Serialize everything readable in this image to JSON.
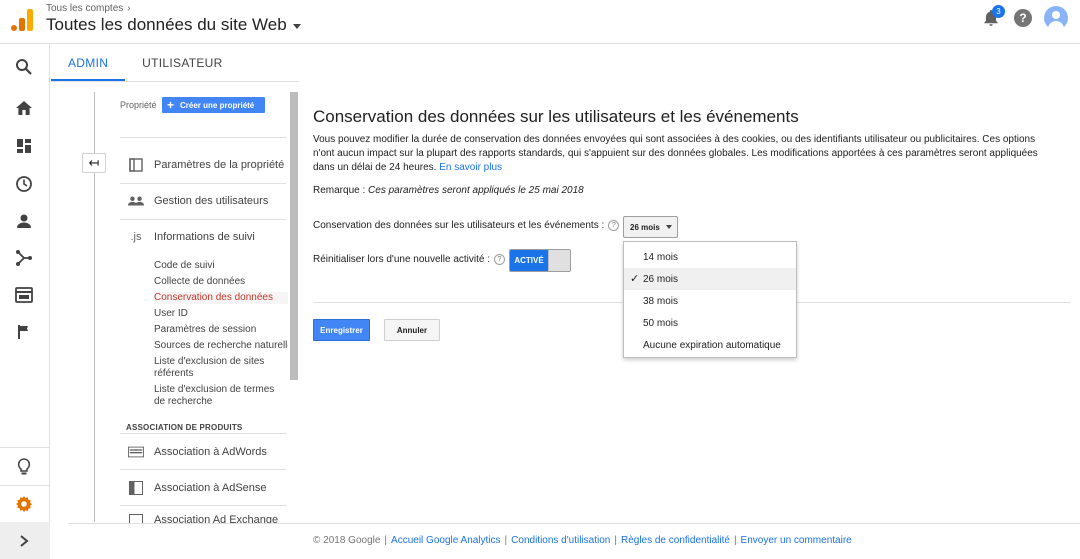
{
  "header": {
    "breadcrumb": "Tous les comptes",
    "title": "Toutes les données du site Web",
    "notification_count": "3",
    "help_glyph": "?"
  },
  "colors": {
    "accent": "#1a73e8",
    "button_blue": "#4285f4",
    "selected_item": "#c0392b",
    "logo_orange": "#f9ab00",
    "logo_dark_orange": "#e37400",
    "settings_orange": "#e37400"
  },
  "leftnav": {
    "icons": [
      "search-icon",
      "home-icon",
      "customization-icon",
      "realtime-clock-icon",
      "audience-person-icon",
      "acquisition-icon",
      "behavior-icon",
      "conversions-flag-icon",
      "discover-lightbulb-icon",
      "admin-gear-icon",
      "expand-chevron-icon"
    ]
  },
  "tabs": [
    {
      "label": "ADMIN",
      "active": true
    },
    {
      "label": "UTILISATEUR",
      "active": false
    }
  ],
  "property": {
    "label": "Propriété",
    "create_button": "Créer une propriété",
    "back_glyph": "↤",
    "sections": [
      {
        "label": "Paramètres de la propriété",
        "icon": "property-settings-icon"
      },
      {
        "label": "Gestion des utilisateurs",
        "icon": "users-icon"
      },
      {
        "label": "Informations de suivi",
        "icon": "js-icon",
        "icon_text": ".js"
      }
    ],
    "tracking_items": [
      "Code de suivi",
      "Collecte de données",
      "Conservation des données",
      "User ID",
      "Paramètres de session",
      "Sources de recherche naturelle",
      "Liste d'exclusion de sites référents",
      "Liste d'exclusion de termes de recherche"
    ],
    "selected_item_index": 2,
    "product_group_title": "ASSOCIATION DE PRODUITS",
    "products": [
      {
        "label": "Association à AdWords",
        "icon": "adwords-icon"
      },
      {
        "label": "Association à AdSense",
        "icon": "adsense-icon"
      },
      {
        "label": "Association Ad Exchange",
        "icon": "ad-exchange-icon"
      }
    ]
  },
  "main": {
    "title": "Conservation des données sur les utilisateurs et les événements",
    "description": "Vous pouvez modifier la durée de conservation des données envoyées qui sont associées à des cookies, ou des identifiants utilisateur ou publicitaires. Ces options n'ont aucun impact sur la plupart des rapports standards, qui s'appuient sur des données globales. Les modifications apportées à ces paramètres seront appliquées dans un délai de 24 heures.",
    "learn_more": "En savoir plus",
    "remark_label": "Remarque :",
    "remark_text": "Ces paramètres seront appliqués le 25 mai 2018",
    "retention_label": "Conservation des données sur les utilisateurs et les événements :",
    "retention_value": "26 mois",
    "retention_options": [
      "14 mois",
      "26 mois",
      "38 mois",
      "50 mois",
      "Aucune expiration automatique"
    ],
    "retention_selected_index": 1,
    "reset_label": "Réinitialiser lors d'une nouvelle activité :",
    "reset_toggle": "ACTIVÉ",
    "save_button": "Enregistrer",
    "cancel_button": "Annuler"
  },
  "footer": {
    "copyright": "© 2018 Google",
    "links": [
      "Accueil Google Analytics",
      "Conditions d'utilisation",
      "Règles de confidentialité",
      "Envoyer un commentaire"
    ],
    "separator": "|"
  }
}
